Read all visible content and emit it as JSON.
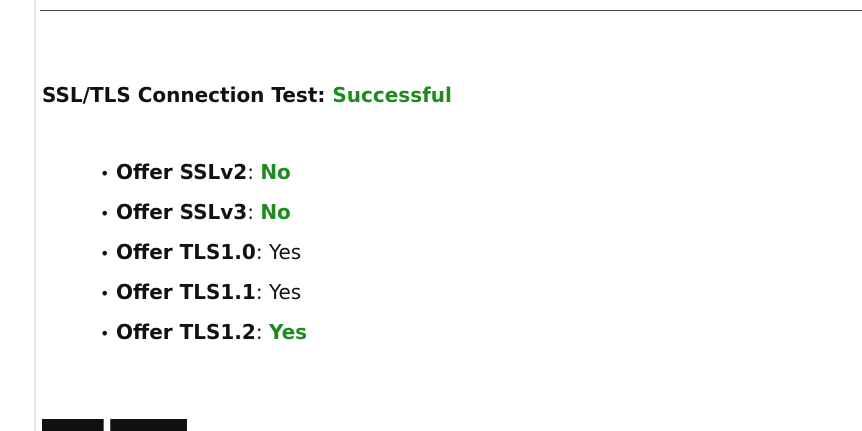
{
  "heading": {
    "label": "SSL/TLS Connection Test:",
    "status": "Successful"
  },
  "options": [
    {
      "label": "Offer SSLv2",
      "value": "No",
      "good": true
    },
    {
      "label": "Offer SSLv3",
      "value": "No",
      "good": true
    },
    {
      "label": "Offer TLS1.0",
      "value": "Yes",
      "good": false
    },
    {
      "label": "Offer TLS1.1",
      "value": "Yes",
      "good": false
    },
    {
      "label": "Offer TLS1.2",
      "value": "Yes",
      "good": true
    }
  ],
  "colors": {
    "good": "#1f8b1f"
  }
}
